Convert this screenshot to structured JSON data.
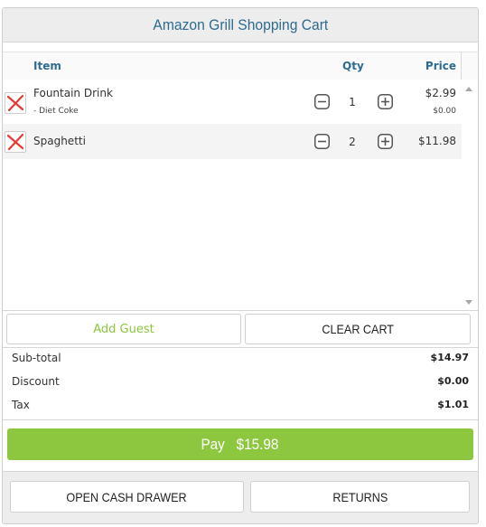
{
  "header": {
    "title": "Amazon Grill Shopping Cart"
  },
  "columns": {
    "item": "Item",
    "qty": "Qty",
    "price": "Price"
  },
  "items": [
    {
      "name": "Fountain Drink",
      "modifier": "- Diet Coke",
      "qty": "1",
      "price": "$2.99",
      "modifier_price": "$0.00"
    },
    {
      "name": "Spaghetti",
      "qty": "2",
      "price": "$11.98"
    }
  ],
  "actions": {
    "add_guest": "Add Guest",
    "clear_cart": "CLEAR CART"
  },
  "totals": {
    "subtotal_label": "Sub-total",
    "subtotal": "$14.97",
    "discount_label": "Discount",
    "discount": "$0.00",
    "tax_label": "Tax",
    "tax": "$1.01"
  },
  "pay": {
    "label": "Pay",
    "amount": "$15.98"
  },
  "footer": {
    "open_cash_drawer": "OPEN CASH DRAWER",
    "returns": "RETURNS"
  },
  "colors": {
    "accent_green": "#8dc63f",
    "title_blue": "#2e6b8f",
    "remove_red": "#e53935"
  }
}
